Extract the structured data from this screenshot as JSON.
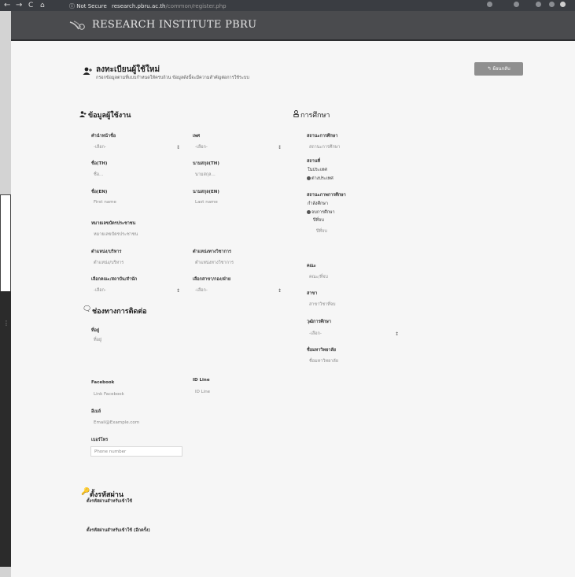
{
  "browser": {
    "back": "←",
    "forward": "→",
    "reload": "C",
    "home": "⌂",
    "security": "ⓘ Not Secure",
    "url_host": "research.pbru.ac.th",
    "url_path": "/common/register.php"
  },
  "header": {
    "brand": "RESEARCH INSTITUTE PBRU"
  },
  "page": {
    "title": "ลงทะเบียนผู้ใช้ใหม่",
    "subtitle": "กรอกข้อมูลตามที่แบบกำหนดให้ครบถ้วน ข้อมูลดังนี้จะมีความสำคัญต่อการใช้ระบบ",
    "back_button": "ย้อนกลับ"
  },
  "user_info": {
    "heading": "ข้อมูลผู้ใช้งาน",
    "prefix": {
      "label": "คำนำหน้าชื่อ",
      "value": "-เลือก-"
    },
    "gender": {
      "label": "เพศ",
      "value": "-เลือก-"
    },
    "name_th": {
      "label": "ชื่อ(TH)",
      "placeholder": "ชื่อ..."
    },
    "surname_th": {
      "label": "นามสกุล(TH)",
      "placeholder": "นามสกุล..."
    },
    "name_en": {
      "label": "ชื่อ(EN)",
      "placeholder": "First name"
    },
    "surname_en": {
      "label": "นามสกุล(EN)",
      "placeholder": "Last name"
    },
    "id_card": {
      "label": "หมายเลขบัตรประชาชน",
      "placeholder": "หมายเลขบัตรประชาชน"
    },
    "position": {
      "label": "ตำแหน่ง/บริหาร",
      "placeholder": "ตำแหน่ง/บริหาร"
    },
    "academic_position": {
      "label": "ตำแหน่งทางวิชาการ",
      "placeholder": "ตำแหน่งทางวิชาการ"
    },
    "faculty": {
      "label": "เลือกคณะ/สถาบัน/สำนัก",
      "value": "-เลือก-"
    },
    "department": {
      "label": "เลือกสาขา/กอง/ฝ่าย",
      "value": "-เลือก-"
    }
  },
  "contact": {
    "heading": "ช่องทางการติดต่อ",
    "address": {
      "label": "ที่อยู่",
      "placeholder": "ที่อยู่"
    },
    "facebook": {
      "label": "Facebook",
      "placeholder": "Link Facebook"
    },
    "line": {
      "label": "ID Line",
      "placeholder": "ID Line"
    },
    "email": {
      "label": "อีเมล์",
      "placeholder": "Email@Example.com"
    },
    "phone": {
      "label": "เบอร์โทร",
      "placeholder": "Phone number"
    }
  },
  "education": {
    "heading": "การศึกษา",
    "status": {
      "label": "สถานะการศึกษา",
      "placeholder": "สถานะการศึกษา"
    },
    "location": {
      "label": "สถานที่",
      "options": [
        "ในประเทศ",
        "ต่างประเทศ"
      ],
      "selected": "ต่างประเทศ"
    },
    "study_state": {
      "label": "สถานะภาพการศึกษา",
      "options": [
        "กำลังศึกษา",
        "จบการศึกษา"
      ],
      "selected": "จบการศึกษา"
    },
    "year": {
      "label": "ปีที่จบ",
      "placeholder": "ปีที่จบ"
    },
    "faculty": {
      "label": "คณะ",
      "placeholder": "คณะ/ที่จบ"
    },
    "major": {
      "label": "สาขา",
      "placeholder": "สาขาวิชาที่จบ"
    },
    "degree": {
      "label": "วุฒิการศึกษา",
      "value": "-เลือก-"
    },
    "university": {
      "label": "ชื่อมหาวิทยาลัย",
      "placeholder": "ชื่อมหาวิทยาลัย"
    }
  },
  "password": {
    "heading": "ตั้งรหัสผ่าน",
    "new": {
      "label": "ตั้งรหัสผ่านสำหรับเข้าใช้"
    },
    "confirm": {
      "label": "ตั้งรหัสผ่านสำหรับเข้าใช้ (อีกครั้ง)"
    }
  },
  "icons": {
    "add_user": "add-user-icon",
    "user": "user-icon",
    "graduation": "graduation-icon",
    "chat": "chat-icon",
    "key": "key-icon",
    "back": "back-arrow-icon"
  },
  "colors": {
    "header_bg": "#4a4b4e",
    "button_bg": "#8f8f8f",
    "page_bg": "#f6f6f6"
  }
}
